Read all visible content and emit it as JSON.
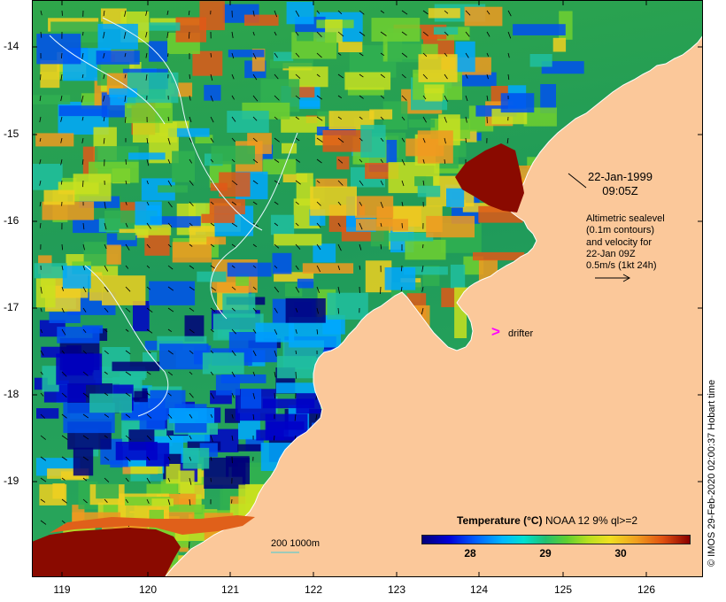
{
  "map": {
    "latitude_labels": [
      "-14",
      "-15",
      "-16",
      "-17",
      "-18",
      "-19"
    ],
    "longitude_labels": [
      "119",
      "120",
      "121",
      "122",
      "123",
      "124",
      "125",
      "126"
    ],
    "annotation_date": [
      "22-Jan-1999",
      "09:05Z"
    ],
    "annotation_altimetry": [
      "Altimetric sealevel",
      "(0.1m contours)",
      "and velocity for",
      "22-Jan 09Z",
      "0.5m/s (1kt 24h)"
    ],
    "drifter_label": "drifter",
    "depth_scale_label": "200  1000m",
    "credit": "© IMOS 29-Feb-2020 02:00:37 Hobart time",
    "colors": {
      "land": "#fbc89a",
      "coast": "#ffffff",
      "drifter": "#ff00ff",
      "contour_1000m": "#66cccc"
    }
  },
  "legend": {
    "title": "Temperature (°C)",
    "subtitle": "NOAA 12 9% ql>=2",
    "ticks": [
      "28",
      "29",
      "30"
    ]
  }
}
